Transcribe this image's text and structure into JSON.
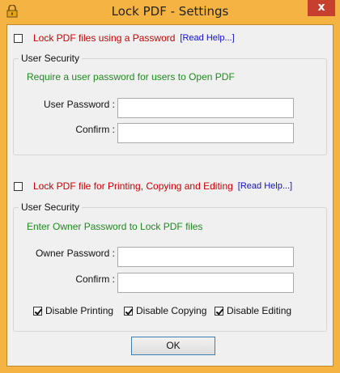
{
  "window": {
    "title": "Lock PDF - Settings",
    "close_glyph": "x"
  },
  "section1": {
    "checkbox_label": "Lock PDF files using a Password",
    "help_link": "[Read Help...]",
    "checked": false,
    "group_title": "User Security",
    "hint": "Require a user password for users to Open PDF",
    "password_label": "User Password :",
    "confirm_label": "Confirm :",
    "password_value": "",
    "confirm_value": ""
  },
  "section2": {
    "checkbox_label": "Lock PDF file for Printing, Copying and Editing",
    "help_link": "[Read Help...]",
    "checked": false,
    "group_title": "User Security",
    "hint": "Enter Owner Password to Lock PDF files",
    "password_label": "Owner Password :",
    "confirm_label": "Confirm :",
    "password_value": "",
    "confirm_value": "",
    "options": [
      {
        "label": "Disable Printing",
        "checked": true
      },
      {
        "label": "Disable Copying",
        "checked": true
      },
      {
        "label": "Disable Editing",
        "checked": true
      }
    ]
  },
  "footer": {
    "ok_label": "OK"
  },
  "colors": {
    "title_bar": "#f5b441",
    "close_button": "#c7402f",
    "checkbox_label": "#cc0000",
    "link": "#1010cc",
    "hint": "#1e8a1e"
  },
  "icons": {
    "app": "padlock-icon",
    "close": "close-icon"
  }
}
